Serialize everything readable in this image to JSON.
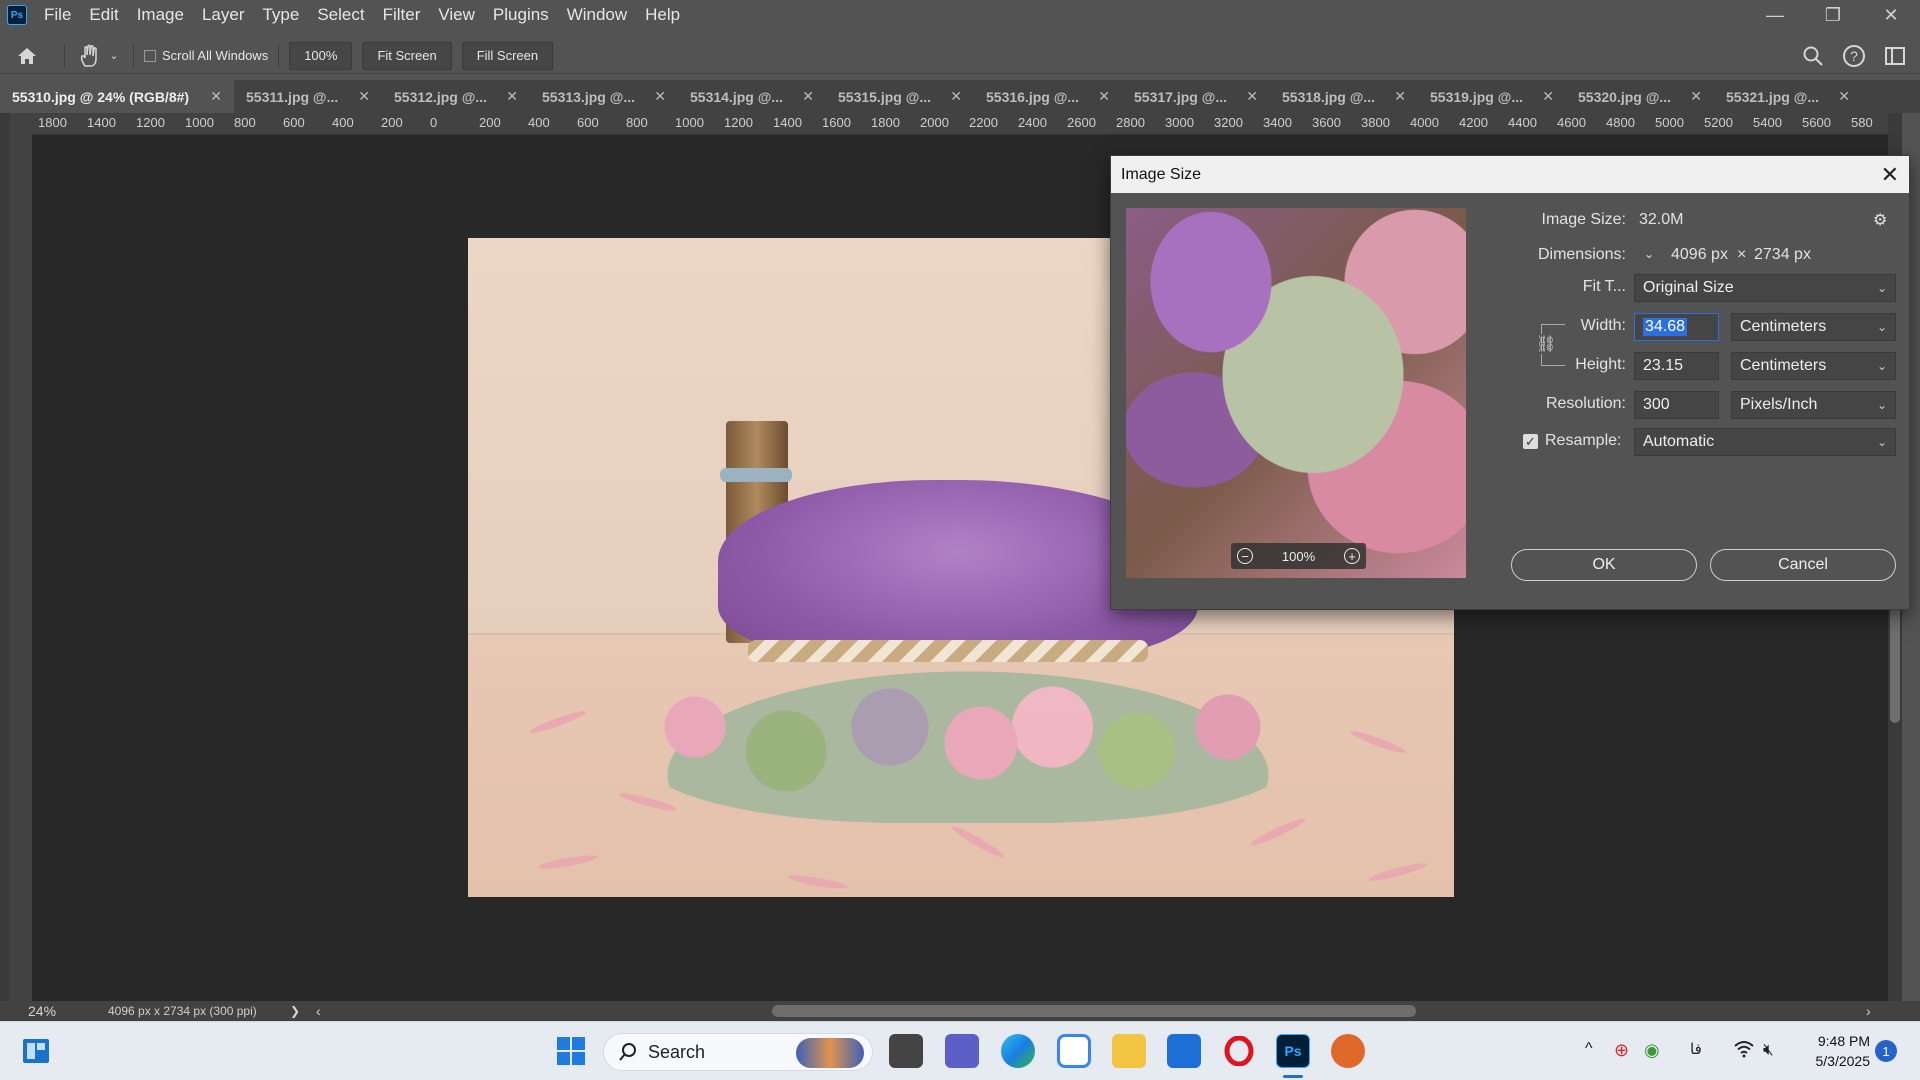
{
  "app": {
    "logo": "Ps"
  },
  "menu": [
    "File",
    "Edit",
    "Image",
    "Layer",
    "Type",
    "Select",
    "Filter",
    "View",
    "Plugins",
    "Window",
    "Help"
  ],
  "window_controls": {
    "minimize": "—",
    "maximize": "❐",
    "close": "✕"
  },
  "options": {
    "scroll_all_label": "Scroll All Windows",
    "zoom_btn": "100%",
    "fit_screen": "Fit Screen",
    "fill_screen": "Fill Screen"
  },
  "tabs": [
    {
      "label": "55310.jpg @ 24% (RGB/8#)",
      "close": "✕"
    },
    {
      "label": "55311.jpg @...",
      "close": "✕"
    },
    {
      "label": "55312.jpg @...",
      "close": "✕"
    },
    {
      "label": "55313.jpg @...",
      "close": "✕"
    },
    {
      "label": "55314.jpg @...",
      "close": "✕"
    },
    {
      "label": "55315.jpg @...",
      "close": "✕"
    },
    {
      "label": "55316.jpg @...",
      "close": "✕"
    },
    {
      "label": "55317.jpg @...",
      "close": "✕"
    },
    {
      "label": "55318.jpg @...",
      "close": "✕"
    },
    {
      "label": "55319.jpg @...",
      "close": "✕"
    },
    {
      "label": "55320.jpg @...",
      "close": "✕"
    },
    {
      "label": "55321.jpg @...",
      "close": "✕"
    }
  ],
  "ruler_h": [
    "1800",
    "1400",
    "1200",
    "1000",
    "800",
    "600",
    "400",
    "200",
    "0",
    "200",
    "400",
    "600",
    "800",
    "1000",
    "1200",
    "1400",
    "1600",
    "1800",
    "2000",
    "2200",
    "2400",
    "2600",
    "2800",
    "3000",
    "3200",
    "3400",
    "3600",
    "3800",
    "4000",
    "4200",
    "4400",
    "4600",
    "4800",
    "5000",
    "5200",
    "5400",
    "5600",
    "580"
  ],
  "status": {
    "zoom": "24%",
    "doc_info": "4096 px x 2734 px (300 ppi)",
    "arrow": "❯",
    "left_arrow": "‹",
    "right_arrow": "›"
  },
  "dialog": {
    "title": "Image Size",
    "close": "✕",
    "preview_zoom": "100%",
    "zoom_out": "−",
    "zoom_in": "+",
    "image_size_label": "Image Size:",
    "image_size_value": "32.0M",
    "gear": "⚙",
    "dimensions_label": "Dimensions:",
    "dimensions_w": "4096 px",
    "dimensions_x": "×",
    "dimensions_h": "2734 px",
    "fit_label": "Fit T...",
    "fit_value": "Original Size",
    "width_label": "Width:",
    "width_value": "34.68",
    "width_unit": "Centimeters",
    "height_label": "Height:",
    "height_value": "23.15",
    "height_unit": "Centimeters",
    "resolution_label": "Resolution:",
    "resolution_value": "300",
    "resolution_unit": "Pixels/Inch",
    "resample_label": "Resample:",
    "resample_checked": true,
    "resample_value": "Automatic",
    "ok": "OK",
    "cancel": "Cancel"
  },
  "taskbar": {
    "search_label": "Search",
    "clock_time": "9:48 PM",
    "clock_date": "5/3/2025",
    "notifications": "1",
    "lang": "فا",
    "ps_label": "Ps",
    "wifi": "wifi-icon",
    "volume": "volume-muted-icon"
  }
}
